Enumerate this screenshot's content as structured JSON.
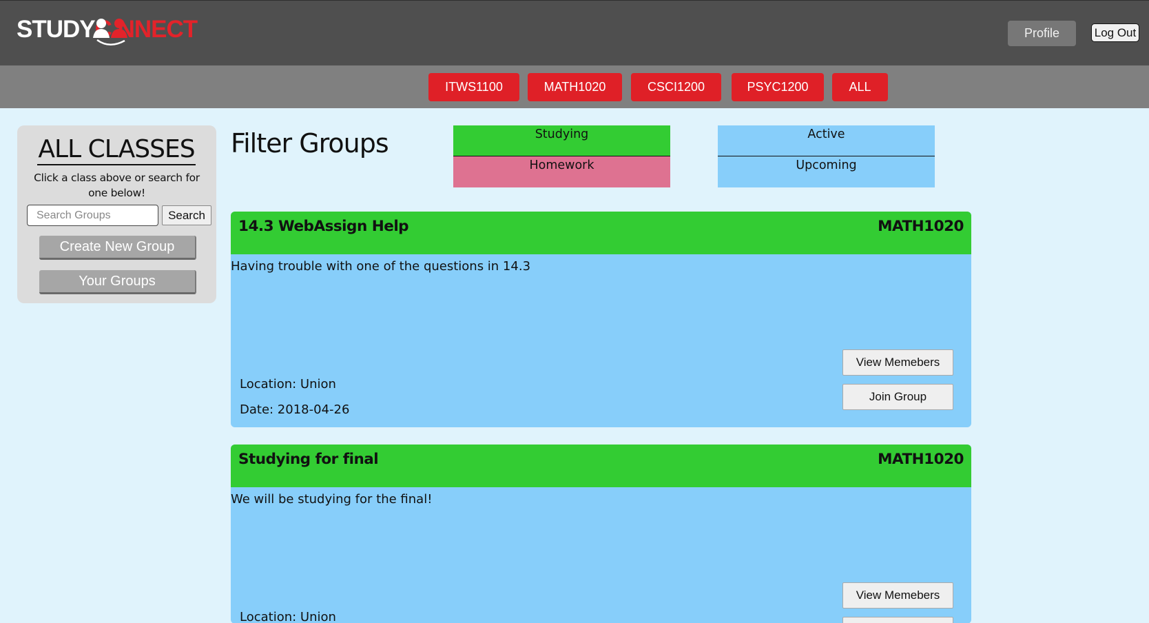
{
  "header": {
    "logo_study": "STUDY",
    "logo_connect": "C  NNECT",
    "profile_label": "Profile",
    "logout_label": "Log Out"
  },
  "classbar": {
    "classes": [
      "ITWS1100",
      "MATH1020",
      "CSCI1200",
      "PSYC1200",
      "ALL"
    ]
  },
  "sidebar": {
    "title": "ALL CLASSES",
    "subtitle": "Click a class above or search for one below!",
    "search_placeholder": "Search Groups",
    "search_label": "Search",
    "create_label": "Create New Group",
    "your_groups_label": "Your Groups"
  },
  "filter": {
    "title": "Filter Groups",
    "studying": "Studying",
    "homework": "Homework",
    "active": "Active",
    "upcoming": "Upcoming",
    "colors": {
      "studying": "#33cc33",
      "homework": "#de7291",
      "status": "#87cefa"
    }
  },
  "groups": [
    {
      "title": "14.3 WebAssign Help",
      "class": "MATH1020",
      "description": "Having trouble with one of the questions in 14.3",
      "location": "Location: Union",
      "date": "Date: 2018-04-26",
      "view_label": "View Memebers",
      "join_label": "Join Group"
    },
    {
      "title": "Studying for final",
      "class": "MATH1020",
      "description": "We will be studying for the final!",
      "location": "Location: Union",
      "view_label": "View Memebers"
    }
  ],
  "colors": {
    "header": "#4f4f4f",
    "classbar": "#808080",
    "accent_red": "#df2027",
    "card_head": "#33cc33",
    "card_body": "#87cefa",
    "page_bg": "#e0f3fc"
  }
}
